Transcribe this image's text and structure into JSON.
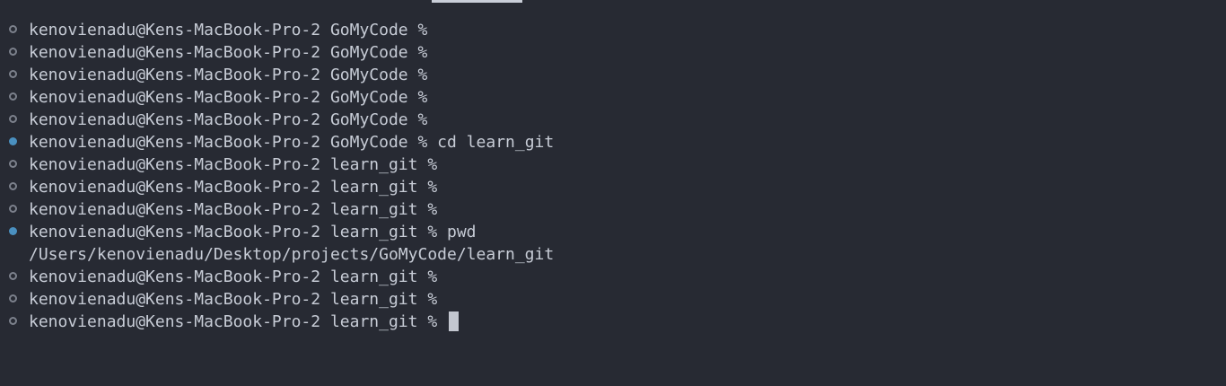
{
  "terminal": {
    "lines": [
      {
        "marker": "idle",
        "prompt": "kenovienadu@Kens-MacBook-Pro-2 GoMyCode %",
        "command": ""
      },
      {
        "marker": "idle",
        "prompt": "kenovienadu@Kens-MacBook-Pro-2 GoMyCode %",
        "command": ""
      },
      {
        "marker": "idle",
        "prompt": "kenovienadu@Kens-MacBook-Pro-2 GoMyCode %",
        "command": ""
      },
      {
        "marker": "idle",
        "prompt": "kenovienadu@Kens-MacBook-Pro-2 GoMyCode %",
        "command": ""
      },
      {
        "marker": "idle",
        "prompt": "kenovienadu@Kens-MacBook-Pro-2 GoMyCode %",
        "command": ""
      },
      {
        "marker": "ran",
        "prompt": "kenovienadu@Kens-MacBook-Pro-2 GoMyCode %",
        "command": "cd learn_git"
      },
      {
        "marker": "idle",
        "prompt": "kenovienadu@Kens-MacBook-Pro-2 learn_git %",
        "command": ""
      },
      {
        "marker": "idle",
        "prompt": "kenovienadu@Kens-MacBook-Pro-2 learn_git %",
        "command": ""
      },
      {
        "marker": "idle",
        "prompt": "kenovienadu@Kens-MacBook-Pro-2 learn_git %",
        "command": ""
      },
      {
        "marker": "ran",
        "prompt": "kenovienadu@Kens-MacBook-Pro-2 learn_git %",
        "command": "pwd"
      },
      {
        "marker": "none",
        "output": "/Users/kenovienadu/Desktop/projects/GoMyCode/learn_git"
      },
      {
        "marker": "idle",
        "prompt": "kenovienadu@Kens-MacBook-Pro-2 learn_git %",
        "command": ""
      },
      {
        "marker": "idle",
        "prompt": "kenovienadu@Kens-MacBook-Pro-2 learn_git %",
        "command": ""
      },
      {
        "marker": "idle",
        "prompt": "kenovienadu@Kens-MacBook-Pro-2 learn_git %",
        "command": "",
        "cursor": true
      }
    ]
  },
  "colors": {
    "background": "#272a33",
    "text": "#c7ccd6",
    "marker_idle": "#7c818c",
    "marker_ran": "#4a90c0",
    "cursor": "#c3c7d0"
  },
  "icons": {
    "marker_idle": "command-idle-circle-icon",
    "marker_ran": "command-executed-dot-icon"
  }
}
